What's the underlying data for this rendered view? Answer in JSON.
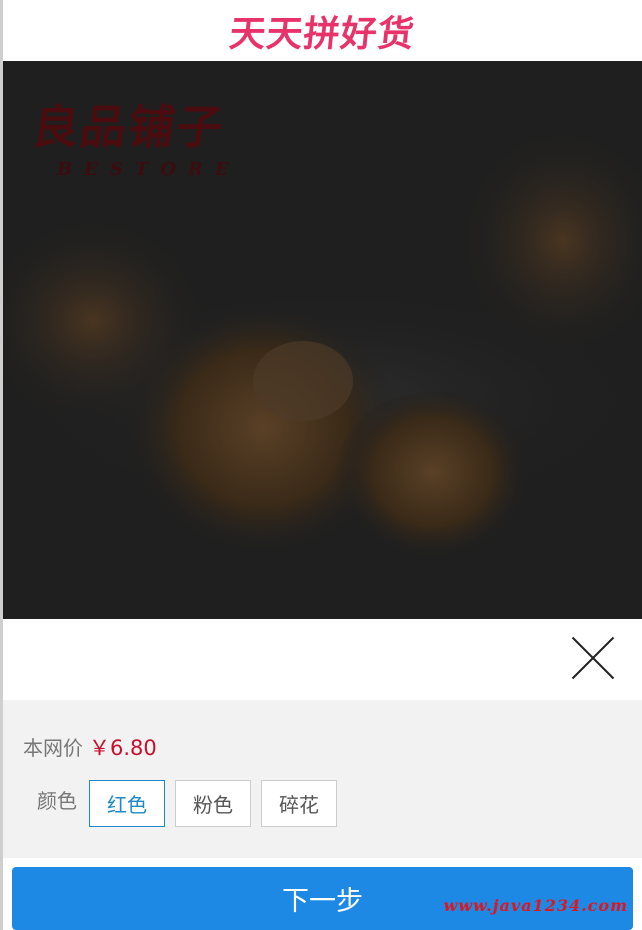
{
  "header": {
    "logo_text": "天天拼好货"
  },
  "hero": {
    "brand_cn": "良品铺子",
    "brand_en": "BESTORE",
    "image_icon": "product-photo-walnut-snacks"
  },
  "close": {
    "icon": "close-icon"
  },
  "panel": {
    "price_label": "本网价",
    "price_value": "￥6.80",
    "color_label": "颜色",
    "options": [
      {
        "label": "红色",
        "selected": true
      },
      {
        "label": "粉色",
        "selected": false
      },
      {
        "label": "碎花",
        "selected": false
      }
    ]
  },
  "footer": {
    "next_label": "下一步",
    "watermark": "www.java1234.com"
  },
  "colors": {
    "accent": "#1e88e5",
    "price": "#c8102e",
    "logo": "#e8336a",
    "selected_option": "#1e88c9"
  }
}
